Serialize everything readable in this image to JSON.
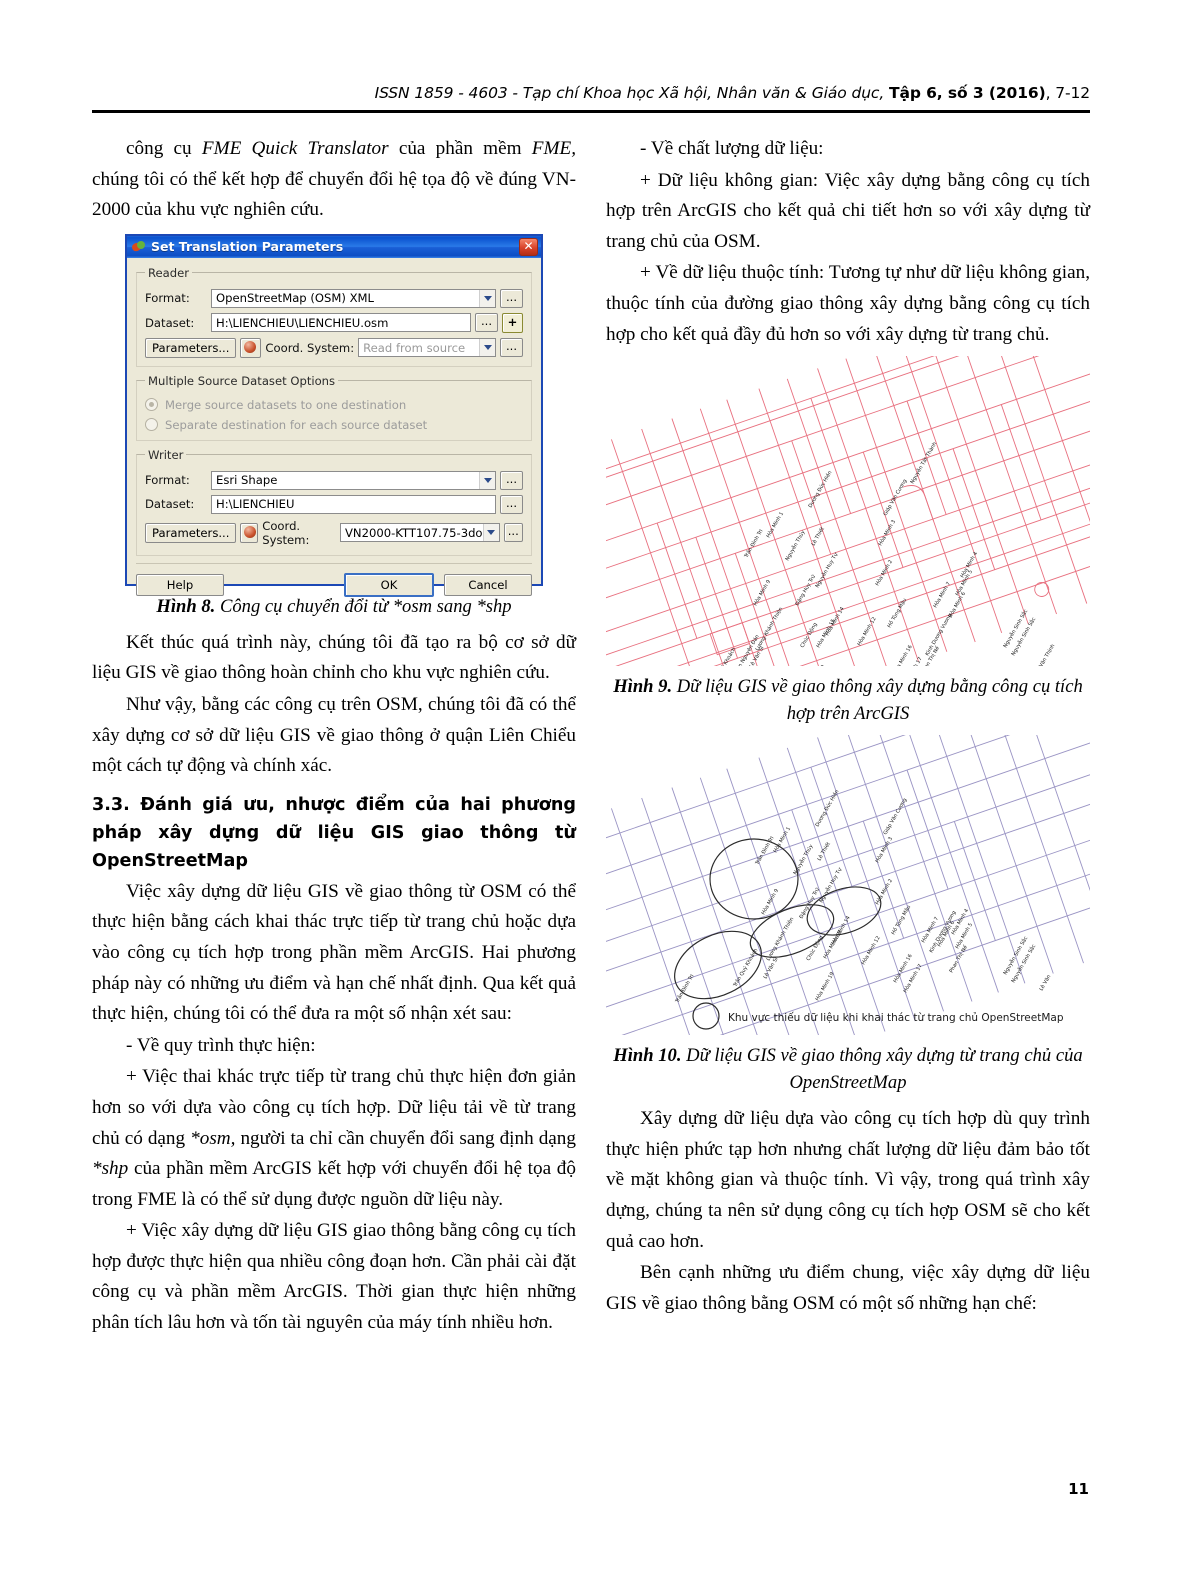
{
  "running_head": {
    "issn_journal": "ISSN 1859 - 4603 - Tạp chí Khoa học Xã hội, Nhân văn & Giáo dục,",
    "volume_bold": "Tập 6, số 3 (2016)",
    "pages": ", 7-12"
  },
  "page_number": "11",
  "left_column": {
    "para1": "công cụ FME Quick Translator của phần mềm FME, chúng tôi có thể kết hợp để chuyển đổi hệ tọa độ về đúng VN-2000 của khu vực nghiên cứu.",
    "para1_italic_1": "FME Quick Translator",
    "para1_italic_2": "FME,",
    "fig8_caption_label": "Hình 8.",
    "fig8_caption_text": " Công cụ chuyển đổi từ *osm sang *shp",
    "para2": "Kết thúc quá trình này, chúng tôi đã tạo ra bộ cơ sở dữ liệu GIS về giao thông hoàn chỉnh cho khu vực nghiên cứu.",
    "para3": "Như vậy, bằng các công cụ trên OSM, chúng tôi đã có thể xây dựng cơ sở dữ liệu GIS về giao thông ở quận Liên Chiểu một cách tự động và chính xác.",
    "heading_3_3": "3.3. Đánh giá ưu, nhược điểm của hai phương pháp xây dựng dữ liệu GIS giao thông từ OpenStreetMap",
    "para4": "Việc xây dựng dữ liệu GIS về giao thông từ OSM có thể thực hiện bằng cách khai thác trực tiếp từ trang chủ hoặc dựa vào công cụ tích hợp trong phần mềm ArcGIS. Hai phương pháp này có những ưu điểm và hạn chế nhất định. Qua kết quả thực hiện, chúng tôi có thể đưa ra một số nhận xét sau:",
    "para5": "- Về quy trình thực hiện:",
    "para6": "+ Việc thai khác trực tiếp từ trang chủ thực hiện đơn giản hơn so với dựa vào công cụ tích hợp. Dữ liệu tải về từ trang chủ có dạng *osm, người ta chỉ cần chuyển đổi sang định dạng *shp của phần mềm ArcGIS kết hợp với chuyển đổi hệ tọa độ trong FME là có thể sử dụng được nguồn dữ liệu này.",
    "para6_italic_1": "*osm,",
    "para6_italic_2": "*shp",
    "para7": "+ Việc xây dựng dữ liệu GIS giao thông bằng công cụ tích hợp được thực hiện qua nhiều công đoạn hơn. Cần phải cài đặt công cụ và phần mềm ArcGIS. Thời gian thực hiện những phân tích lâu hơn và tốn tài nguyên của máy tính nhiều hơn."
  },
  "right_column": {
    "para1": "- Về chất lượng dữ liệu:",
    "para2": "+ Dữ liệu không gian: Việc xây dựng bằng công cụ tích hợp trên ArcGIS cho kết quả chi tiết hơn so với xây dựng từ trang chủ của OSM.",
    "para3": "+ Về dữ liệu thuộc tính: Tương tự như dữ liệu không gian, thuộc tính của đường giao thông xây dựng bằng công cụ tích hợp cho kết quả đầy đủ hơn so với xây dựng từ trang chủ.",
    "fig9_caption_label": "Hình 9.",
    "fig9_caption_text": " Dữ liệu GIS về giao thông xây dựng bằng công cụ tích hợp trên ArcGIS",
    "fig10_caption_label": "Hình 10.",
    "fig10_caption_text": " Dữ liệu GIS về giao thông xây dựng từ trang chủ của OpenStreetMap",
    "fig10_legend": "Khu vực thiếu dữ liệu khi khai thác từ trang chủ OpenStreetMap",
    "para4": "Xây dựng dữ liệu dựa vào công cụ tích hợp dù quy trình thực hiện phức tạp hơn nhưng chất lượng dữ liệu đảm bảo tốt về mặt không gian và thuộc tính. Vì vậy, trong quá trình xây dựng, chúng ta nên sử dụng công cụ tích hợp OSM sẽ cho kết quả cao hơn.",
    "para5": "Bên cạnh những ưu điểm chung, việc xây dựng dữ liệu GIS về giao thông bằng OSM có một số những hạn chế:"
  },
  "fme_dialog": {
    "title": "Set Translation Parameters",
    "close_label": "✕",
    "reader_group": "Reader",
    "reader_format_label": "Format:",
    "reader_format_value": "OpenStreetMap (OSM) XML",
    "reader_dataset_label": "Dataset:",
    "reader_dataset_value": "H:\\LIENCHIEU\\LIENCHIEU.osm",
    "reader_parameters_button": "Parameters...",
    "reader_coordsys_label": "Coord. System:",
    "reader_coordsys_value": "Read from source",
    "multi_group": "Multiple Source Dataset Options",
    "radio_merge": "Merge source datasets to one destination",
    "radio_separate": "Separate destination for each source dataset",
    "writer_group": "Writer",
    "writer_format_label": "Format:",
    "writer_format_value": "Esri Shape",
    "writer_dataset_label": "Dataset:",
    "writer_dataset_value": "H:\\LIENCHIEU",
    "writer_parameters_button": "Parameters...",
    "writer_coordsys_label": "Coord. System:",
    "writer_coordsys_value": "VN2000-KTT107.75-3do",
    "help_button": "Help",
    "ok_button": "OK",
    "cancel_button": "Cancel",
    "browse_button": "...",
    "add_button": "+"
  },
  "map_colors": {
    "figure9_stroke": "#e8707f",
    "figure10_stroke": "#9a94c4",
    "figure10_annotation": "#2b2b2b"
  },
  "map_street_labels": [
    "Trần Đình Tri",
    "Hòa Minh 1",
    "Dương Đức Hiền",
    "Lê Thiết",
    "Nguyễn Thúy",
    "Giáp Văn Cương",
    "Nguyễn Tất Thành",
    "Hòa Minh 3",
    "Hòa Minh 2",
    "Hòa Minh 4",
    "Hòa Minh 5",
    "Hòa Minh 6",
    "Hòa Minh 7",
    "Hòa Minh 9",
    "Nguyễn Huy Tự",
    "Đặng Huy Trứ",
    "Hòa Minh 14",
    "Hòa Minh 15",
    "Hòa Minh 12",
    "Chúc Động",
    "Lương Khánh Thiện",
    "Lê Văn Sĩ",
    "Trần Nguyên Đán",
    "Trần Quý Khoách",
    "Đinh Đức Thiện",
    "Hòa Minh 19",
    "Hòa Minh 20",
    "Hòa Minh 16",
    "Hòa Minh 17",
    "Hồ Tùng Mậu",
    "Phan Thị Nể",
    "Kinh Dương Vương",
    "Nguyễn Sinh Sắc",
    "Lê Văn Thịnh"
  ]
}
